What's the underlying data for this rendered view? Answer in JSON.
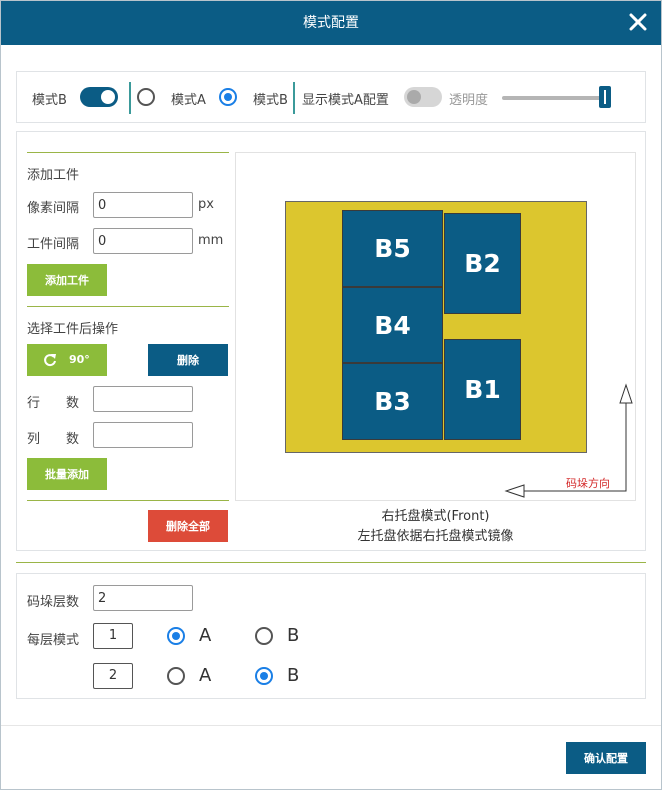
{
  "dialog": {
    "title": "模式配置"
  },
  "toolbar": {
    "mode_b_label": "模式B",
    "mode_a_radio": "模式A",
    "mode_b_radio": "模式B",
    "show_mode_a_config": "显示模式A配置",
    "opacity_label": "透明度"
  },
  "left_panel": {
    "add_workpiece_heading": "添加工件",
    "pixel_spacing_label": "像素间隔",
    "pixel_spacing_value": "0",
    "pixel_unit": "px",
    "piece_spacing_label": "工件间隔",
    "piece_spacing_value": "0",
    "piece_unit": "mm",
    "add_piece_button": "添加工件",
    "after_select_heading": "选择工件后操作",
    "rotate_button": "90°",
    "delete_button": "删除",
    "rows_label": "行　　数",
    "rows_value": "",
    "cols_label": "列　　数",
    "cols_value": "",
    "batch_add_button": "批量添加",
    "delete_all_button": "删除全部"
  },
  "canvas": {
    "boxes": [
      "B5",
      "B2",
      "B4",
      "B1",
      "B3"
    ],
    "direction_label": "码垛方向",
    "caption_line1": "右托盘模式(Front)",
    "caption_line2": "左托盘依据右托盘模式镜像"
  },
  "bottom": {
    "stack_layers_label": "码垛层数",
    "stack_layers_value": "2",
    "layer_mode_label": "每层模式",
    "layers": [
      {
        "num": "1",
        "a_label": "A",
        "b_label": "B",
        "selected": "A"
      },
      {
        "num": "2",
        "a_label": "A",
        "b_label": "B",
        "selected": "B"
      }
    ]
  },
  "footer": {
    "confirm_button": "确认配置"
  },
  "colors": {
    "primary": "#0b5c85",
    "green": "#8cbc3a",
    "red": "#dd4b39",
    "tray": "#dcc62e",
    "radio": "#1a7fe6"
  }
}
